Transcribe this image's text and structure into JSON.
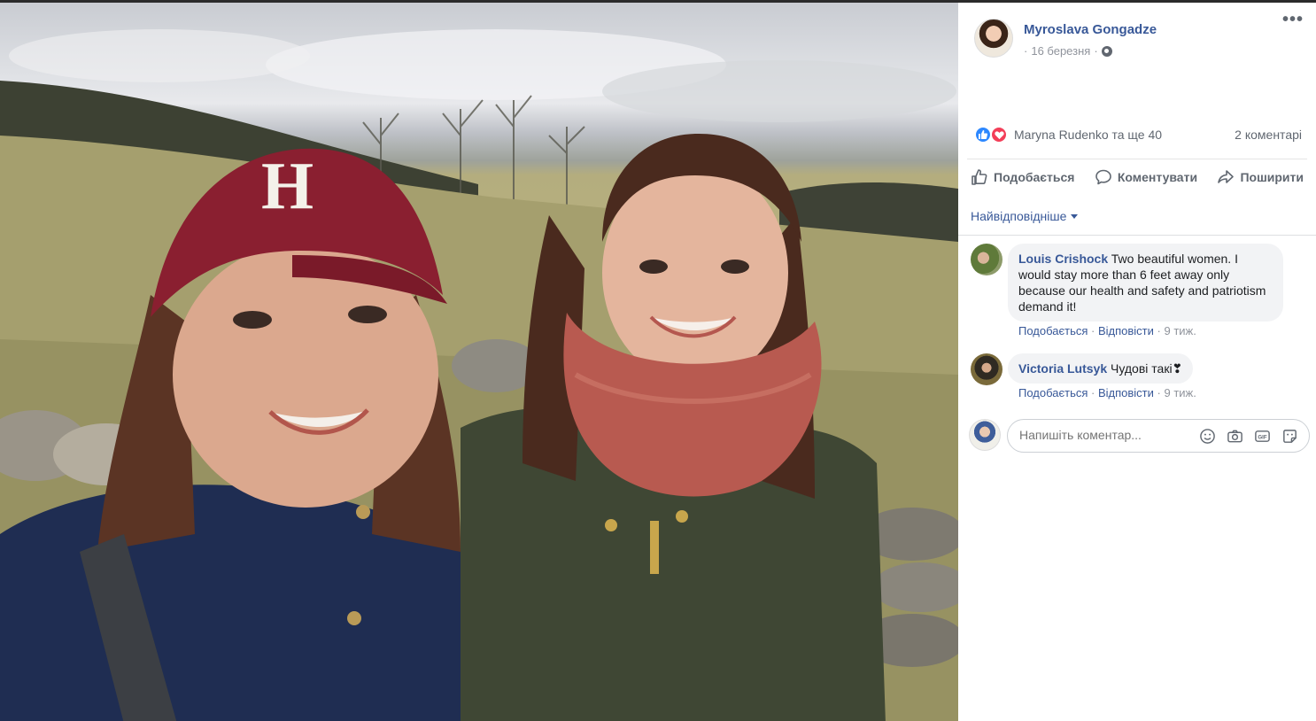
{
  "post": {
    "author": "Myroslava Gongadze",
    "date": "16 березня",
    "separator": "·",
    "more": "•••"
  },
  "reactions": {
    "people": "Maryna Rudenko та ще 40",
    "comment_count": "2 коментарі"
  },
  "actions": {
    "like": "Подобається",
    "comment": "Коментувати",
    "share": "Поширити"
  },
  "sort": {
    "label": "Найвідповідніше"
  },
  "comments": [
    {
      "name": "Louis Crishock",
      "text": "Two beautiful women. I would stay more than 6 feet away only because our health and safety and patriotism demand it!",
      "like": "Подобається",
      "reply": "Відповісти",
      "time": "9 тиж."
    },
    {
      "name": "Victoria Lutsyk",
      "text": "Чудові такі❣",
      "like": "Подобається",
      "reply": "Відповісти",
      "time": "9 тиж."
    }
  ],
  "composer": {
    "placeholder": "Напишіть коментар..."
  },
  "icons": {
    "like": "thumbs-up-icon",
    "love": "heart-icon",
    "privacy": "globe-icon",
    "comment": "speech-bubble-icon",
    "share": "share-arrow-icon",
    "emoji": "smiley-icon",
    "camera": "camera-icon",
    "gif": "gif-icon",
    "sticker": "sticker-icon"
  },
  "photo": {
    "cap_letter": "H"
  },
  "colors": {
    "link": "#385898",
    "like_blue": "#2d88ff",
    "love_red": "#f33e58",
    "muted": "#90949c"
  }
}
